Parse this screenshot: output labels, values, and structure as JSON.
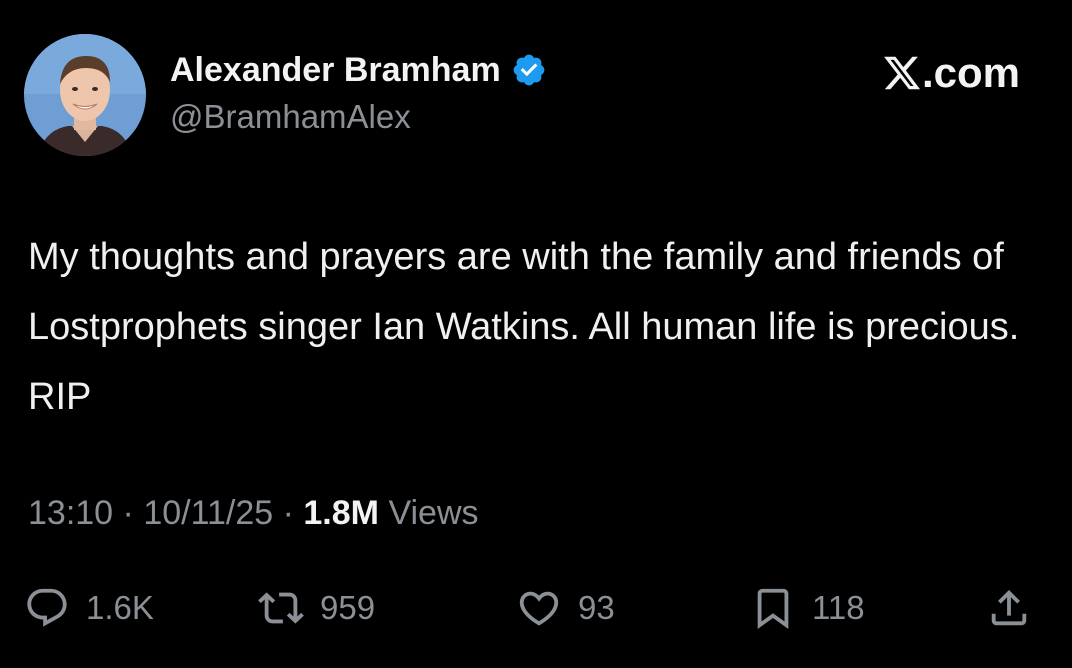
{
  "author": {
    "display_name": "Alexander Bramham",
    "handle": "@BramhamAlex",
    "verified": true,
    "verified_badge_color": "#1d9bf0",
    "avatar": "profile-photo"
  },
  "brand": {
    "label": ".com",
    "logo": "x-logo-icon"
  },
  "tweet": {
    "text": "My thoughts and prayers are with the family and friends of Lostprophets singer Ian Watkins. All human life is precious. RIP",
    "time": "13:10",
    "separator": "·",
    "date": "10/11/25",
    "views_count": "1.8M",
    "views_label": "Views"
  },
  "actions": {
    "replies": {
      "icon": "reply-icon",
      "count": "1.6K"
    },
    "reposts": {
      "icon": "repost-icon",
      "count": "959"
    },
    "likes": {
      "icon": "heart-icon",
      "count": "93"
    },
    "bookmarks": {
      "icon": "bookmark-icon",
      "count": "118"
    },
    "share": {
      "icon": "share-icon"
    }
  },
  "colors": {
    "background": "#000000",
    "primary_text": "#e7e9ea",
    "secondary_text": "#8b9096",
    "accent": "#1d9bf0"
  }
}
